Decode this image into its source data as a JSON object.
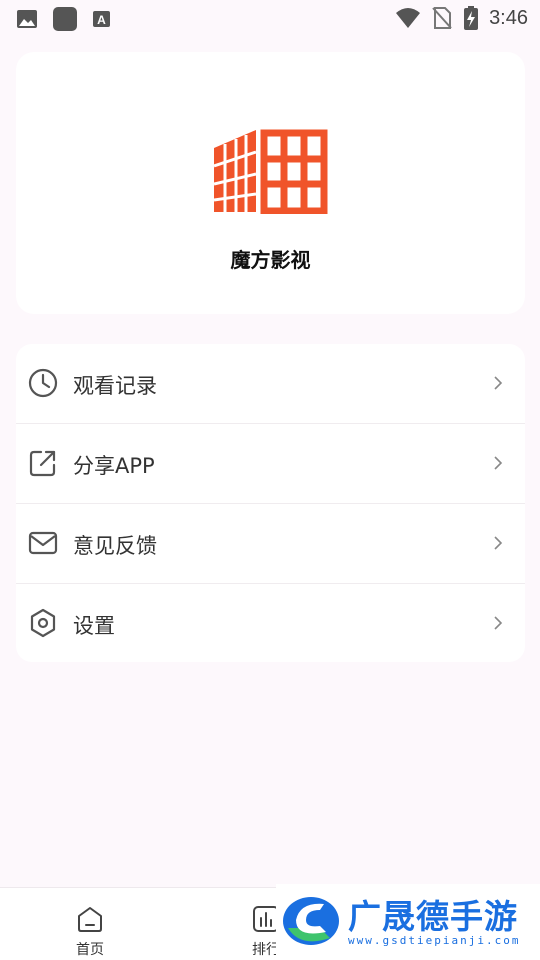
{
  "status_bar": {
    "time": "3:46",
    "icons": [
      "image-icon",
      "square-icon",
      "a-icon",
      "wifi-icon",
      "no-sim-icon",
      "battery-charging-icon"
    ]
  },
  "header": {
    "app_name": "魔方影视",
    "logo_color": "#f0542a"
  },
  "menu": {
    "items": [
      {
        "label": "观看记录",
        "icon": "clock-icon"
      },
      {
        "label": "分享APP",
        "icon": "share-icon"
      },
      {
        "label": "意见反馈",
        "icon": "mail-icon"
      },
      {
        "label": "设置",
        "icon": "settings-icon"
      }
    ]
  },
  "bottom_nav": {
    "items": [
      {
        "label": "首页",
        "icon": "home-icon"
      },
      {
        "label": "排行",
        "icon": "chart-icon"
      }
    ]
  },
  "watermark": {
    "title": "广晟德手游",
    "url": "www.gsdtiepianji.com",
    "color": "#1a6fe0"
  }
}
